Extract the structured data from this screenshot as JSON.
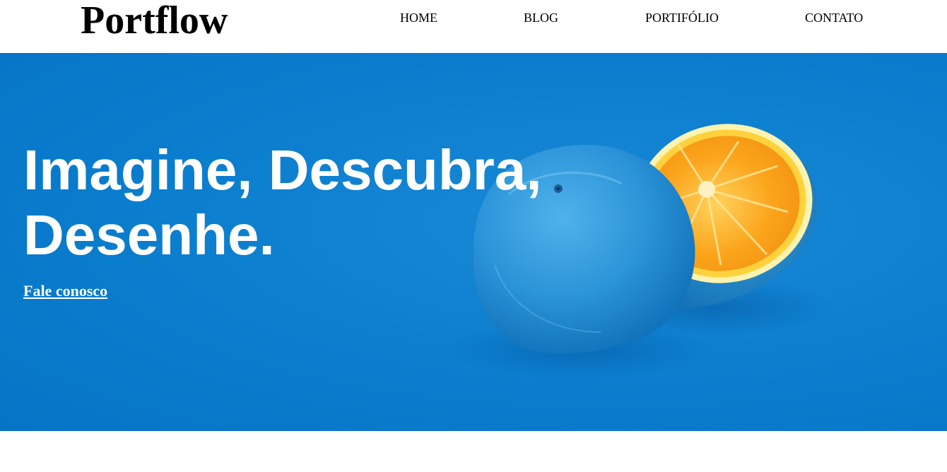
{
  "header": {
    "logo": "Portflow",
    "nav": {
      "home": "HOME",
      "blog": "BLOG",
      "portfolio": "PORTIFÓLIO",
      "contact": "CONTATO"
    }
  },
  "hero": {
    "title_line1": "Imagine, Descubra,",
    "title_line2": "Desenhe.",
    "cta": "Fale conosco",
    "image": "blue-painted-orange-cut-in-half",
    "colors": {
      "background": "#0a7bcb",
      "orange_flesh": "#f9a51a",
      "orange_rind": "#ffd84a",
      "peel_blue": "#2b93d8"
    }
  }
}
